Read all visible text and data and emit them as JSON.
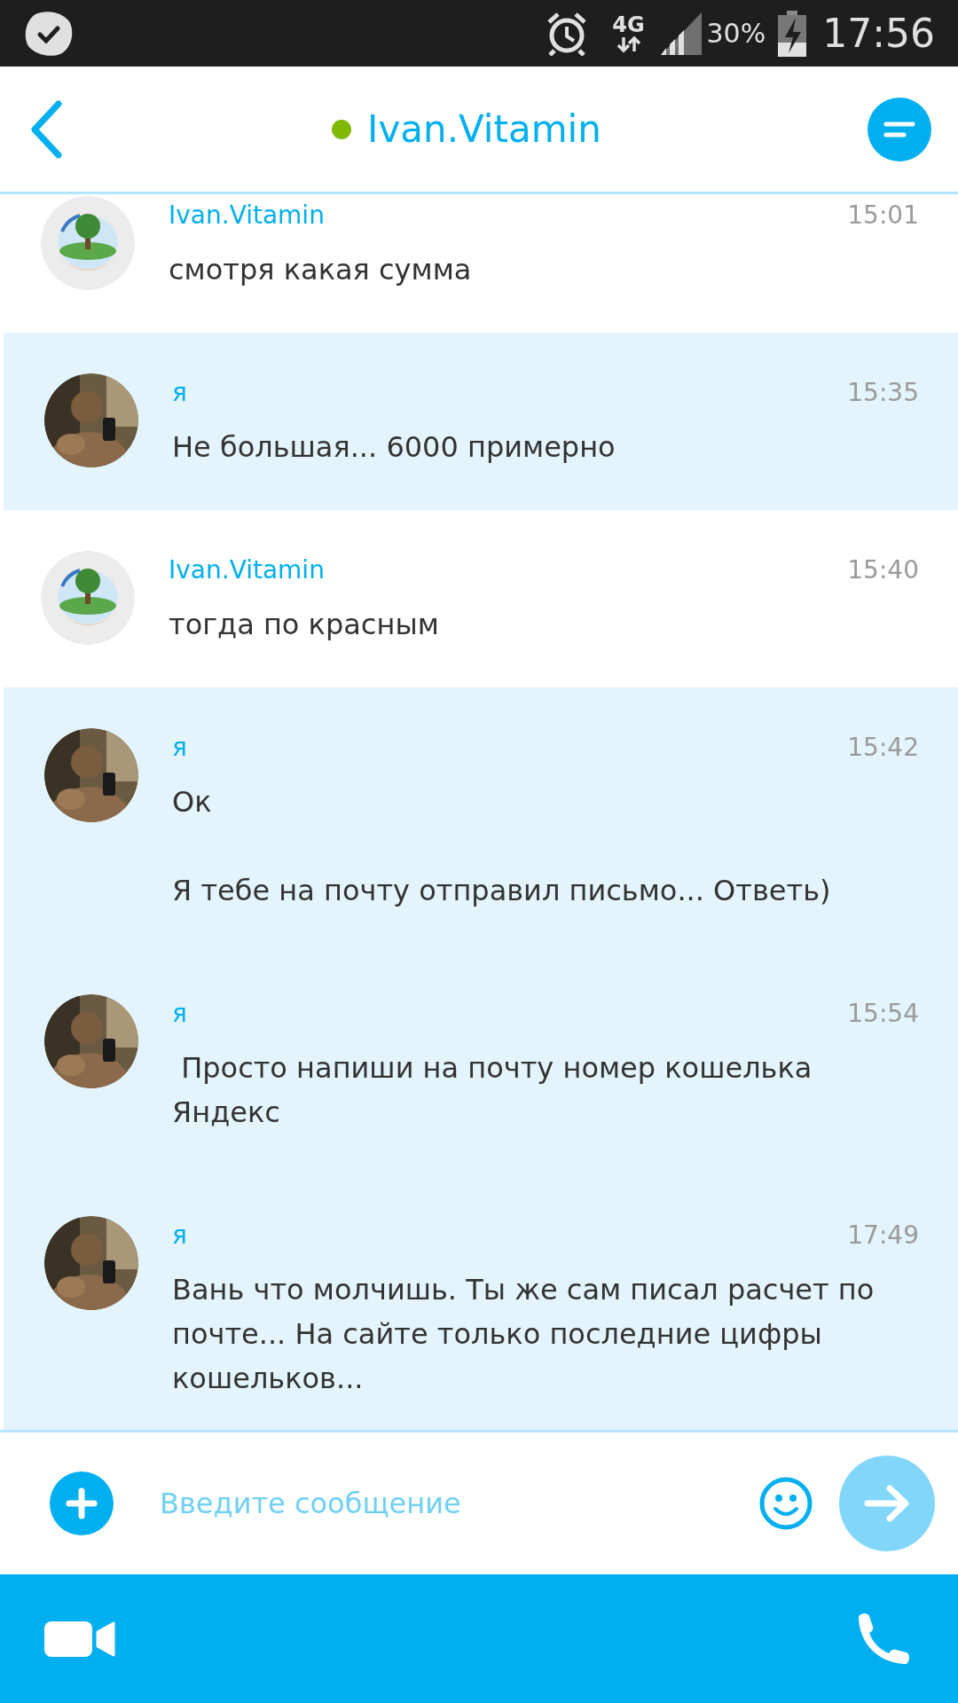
{
  "status_bar": {
    "network": "4G",
    "battery": "30%",
    "time": "17:56"
  },
  "header": {
    "title": "Ivan.Vitamin",
    "online": true
  },
  "messages": [
    {
      "sender": "Ivan.Vitamin",
      "time": "15:01",
      "text": "смотря какая сумма",
      "own": false
    },
    {
      "sender": "я",
      "time": "15:35",
      "text": "Не большая... 6000 примерно",
      "own": true
    },
    {
      "sender": "Ivan.Vitamin",
      "time": "15:40",
      "text": "тогда по красным",
      "own": false
    },
    {
      "sender": "я",
      "time": "15:42",
      "text": "Ок\n\nЯ тебе на почту отправил письмо... Ответь)",
      "own": true
    },
    {
      "sender": "я",
      "time": "15:54",
      "text": " Просто напиши на почту номер кошелька Яндекс",
      "own": true
    },
    {
      "sender": "я",
      "time": "17:49",
      "text": "Вань что молчишь. Ты же сам писал расчет по почте... На сайте только последние цифры кошельков...",
      "own": true
    }
  ],
  "composer": {
    "placeholder": "Введите сообщение"
  }
}
